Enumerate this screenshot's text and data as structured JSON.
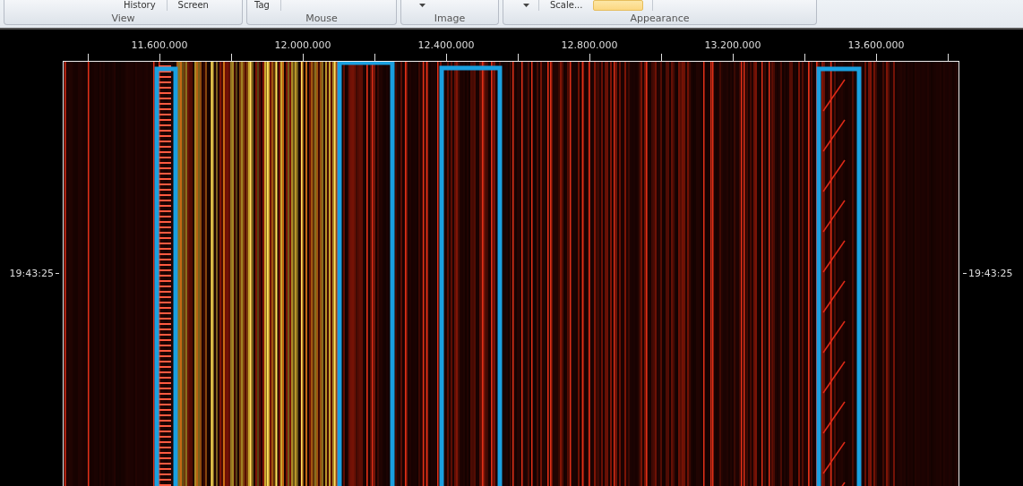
{
  "ribbon": {
    "groups": [
      {
        "label": "View",
        "items": [
          {
            "kind": "button",
            "label": "History",
            "selected": false
          },
          {
            "kind": "separator"
          },
          {
            "kind": "button",
            "label": "Screen",
            "selected": false
          }
        ]
      },
      {
        "label": "Mouse",
        "items": [
          {
            "kind": "button",
            "label": "Tag",
            "selected": false
          },
          {
            "kind": "separator"
          }
        ]
      },
      {
        "label": "Image",
        "items": [
          {
            "kind": "dropdown"
          }
        ]
      },
      {
        "label": "Appearance",
        "items": [
          {
            "kind": "dropdown"
          },
          {
            "kind": "separator"
          },
          {
            "kind": "button",
            "label": "Scale...",
            "selected": false
          },
          {
            "kind": "button",
            "selected": true
          },
          {
            "kind": "separator"
          }
        ]
      }
    ]
  },
  "spectrogram": {
    "frequency_labels": [
      "11.600.000",
      "12.000.000",
      "12.400.000",
      "12.800.000",
      "13.200.000",
      "13.600.000"
    ],
    "time_label_left": "19:43:25",
    "time_label_right": "19:43:25"
  }
}
